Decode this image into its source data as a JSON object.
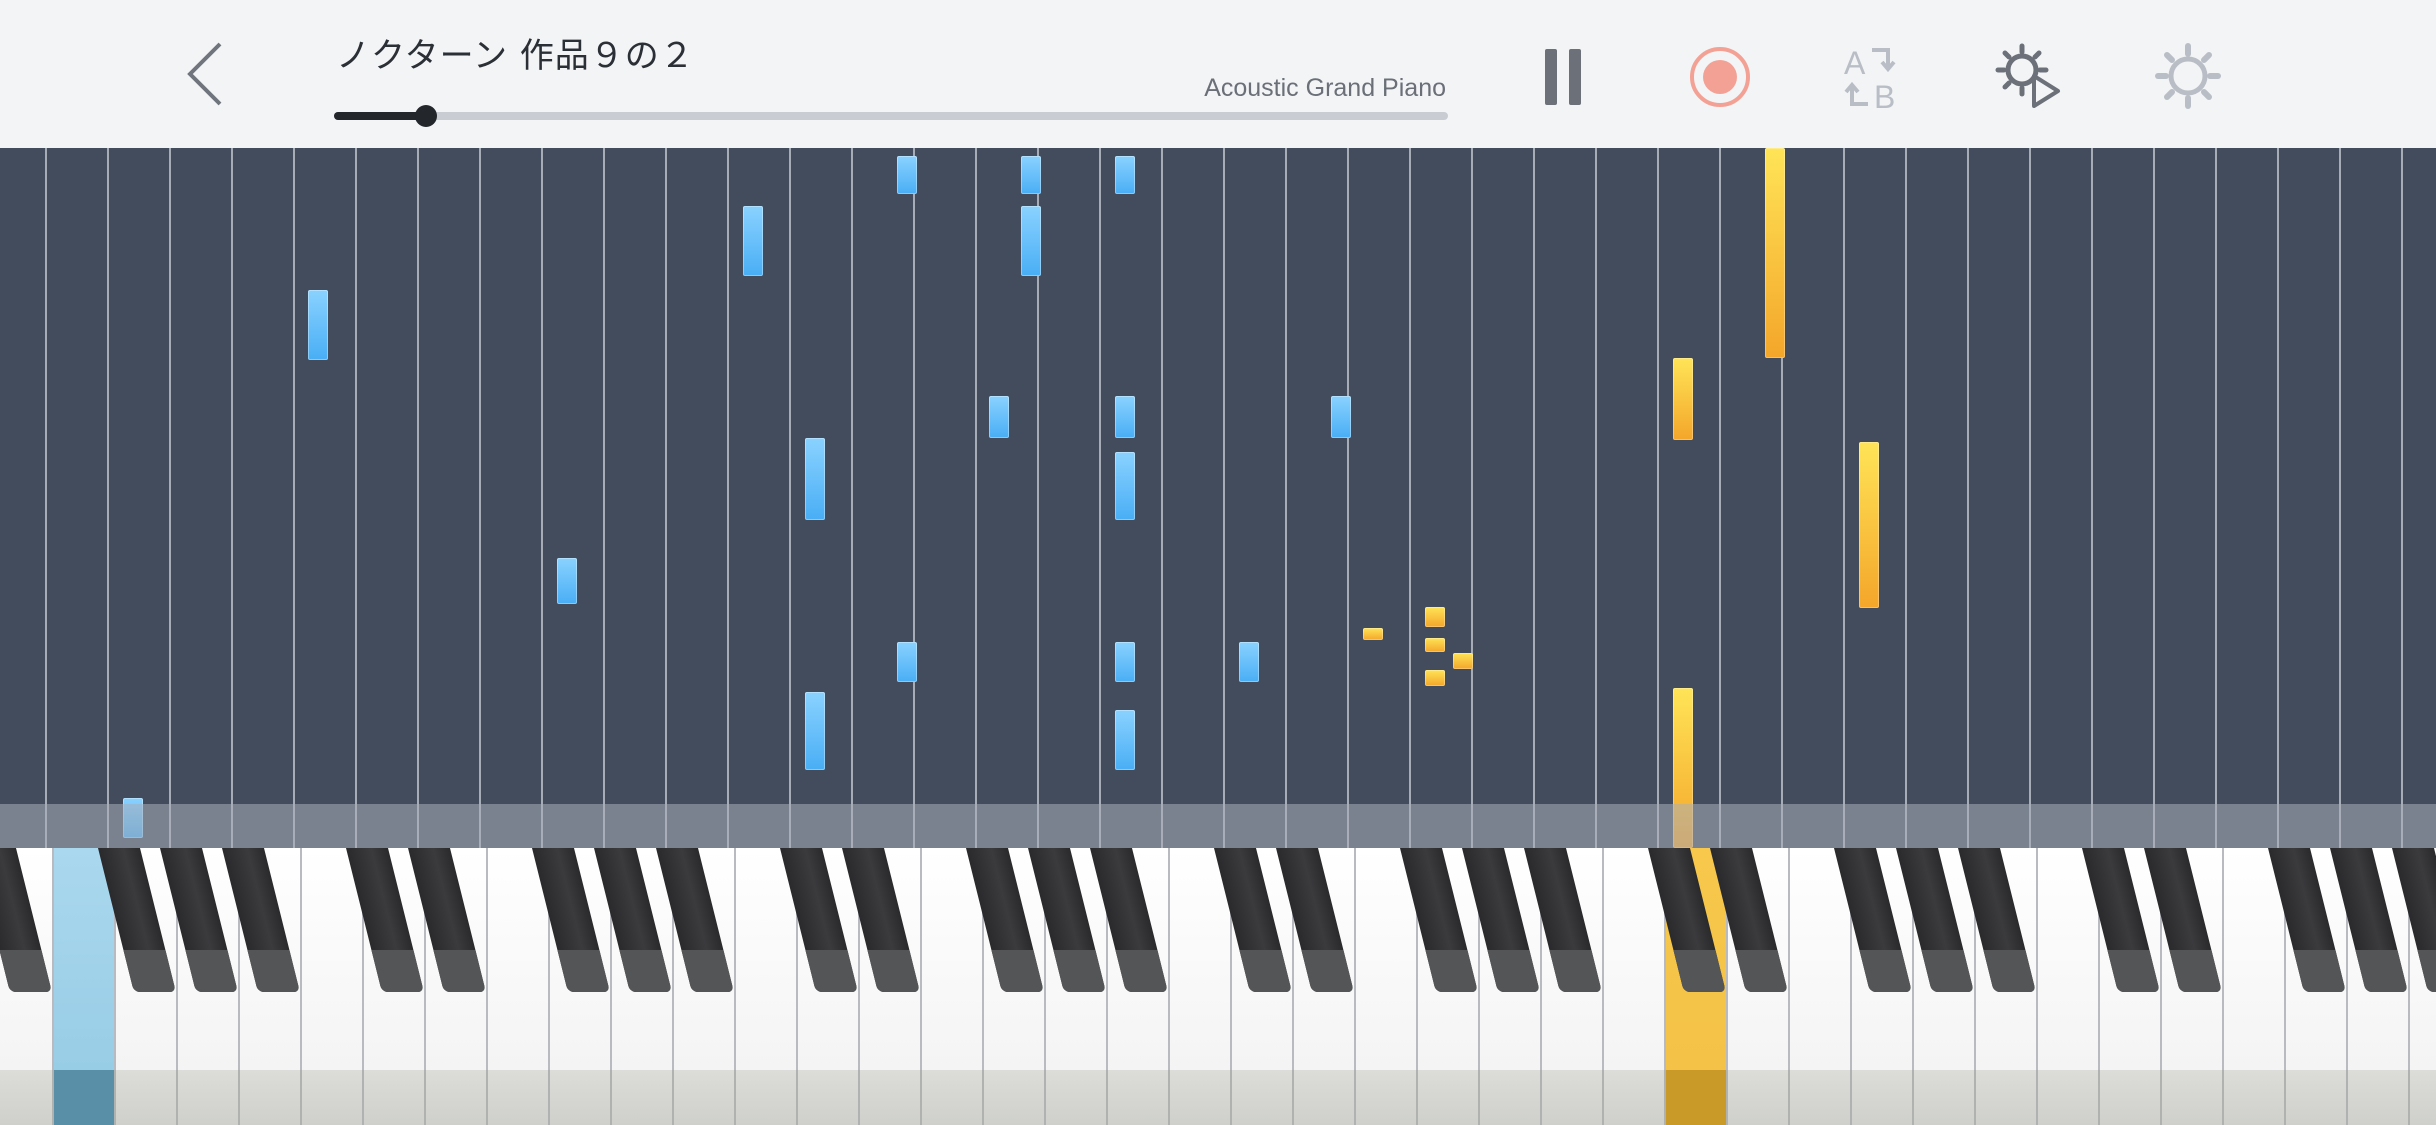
{
  "header": {
    "title": "ノクターン 作品９の２",
    "instrument": "Acoustic Grand Piano",
    "progress": 0.083
  },
  "controls": {
    "back_icon": "chevron-left-icon",
    "pause_icon": "pause-icon",
    "record_icon": "record-icon",
    "ab_repeat_icon": "ab-repeat-icon",
    "play_settings_icon": "gear-play-icon",
    "settings_icon": "gear-icon"
  },
  "colors": {
    "header_bg": "#f3f4f6",
    "roll_bg": "#424c5c",
    "right_hand_note": "#f4c93a",
    "left_hand_note": "#5bbcf7",
    "record_accent": "#f3a195"
  },
  "keyboard": {
    "pressed_left_hand": "blue",
    "pressed_right_hand": "yellow"
  }
}
